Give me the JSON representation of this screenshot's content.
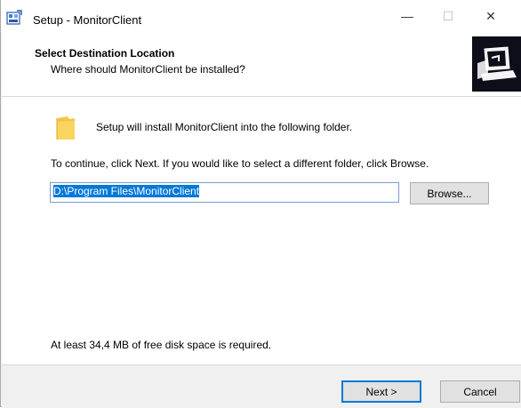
{
  "window": {
    "title": "Setup - MonitorClient",
    "minimize_glyph": "—",
    "maximize_glyph": "☐",
    "close_glyph": "✕"
  },
  "header": {
    "title": "Select Destination Location",
    "subtitle": "Where should MonitorClient be installed?",
    "logo_icon": "computer-install-icon"
  },
  "content": {
    "intro": "Setup will install MonitorClient into the following folder.",
    "instruction": "To continue, click Next. If you would like to select a different folder, click Browse.",
    "path_value": "D:\\Program Files\\MonitorClient",
    "browse_label": "Browse...",
    "disk_space": "At least 34,4 MB of free disk space is required."
  },
  "footer": {
    "next_label": "Next >",
    "cancel_label": "Cancel"
  },
  "colors": {
    "accent": "#0078d7",
    "logo_bg": "#0c0e1a",
    "folder": "#f5c542"
  }
}
